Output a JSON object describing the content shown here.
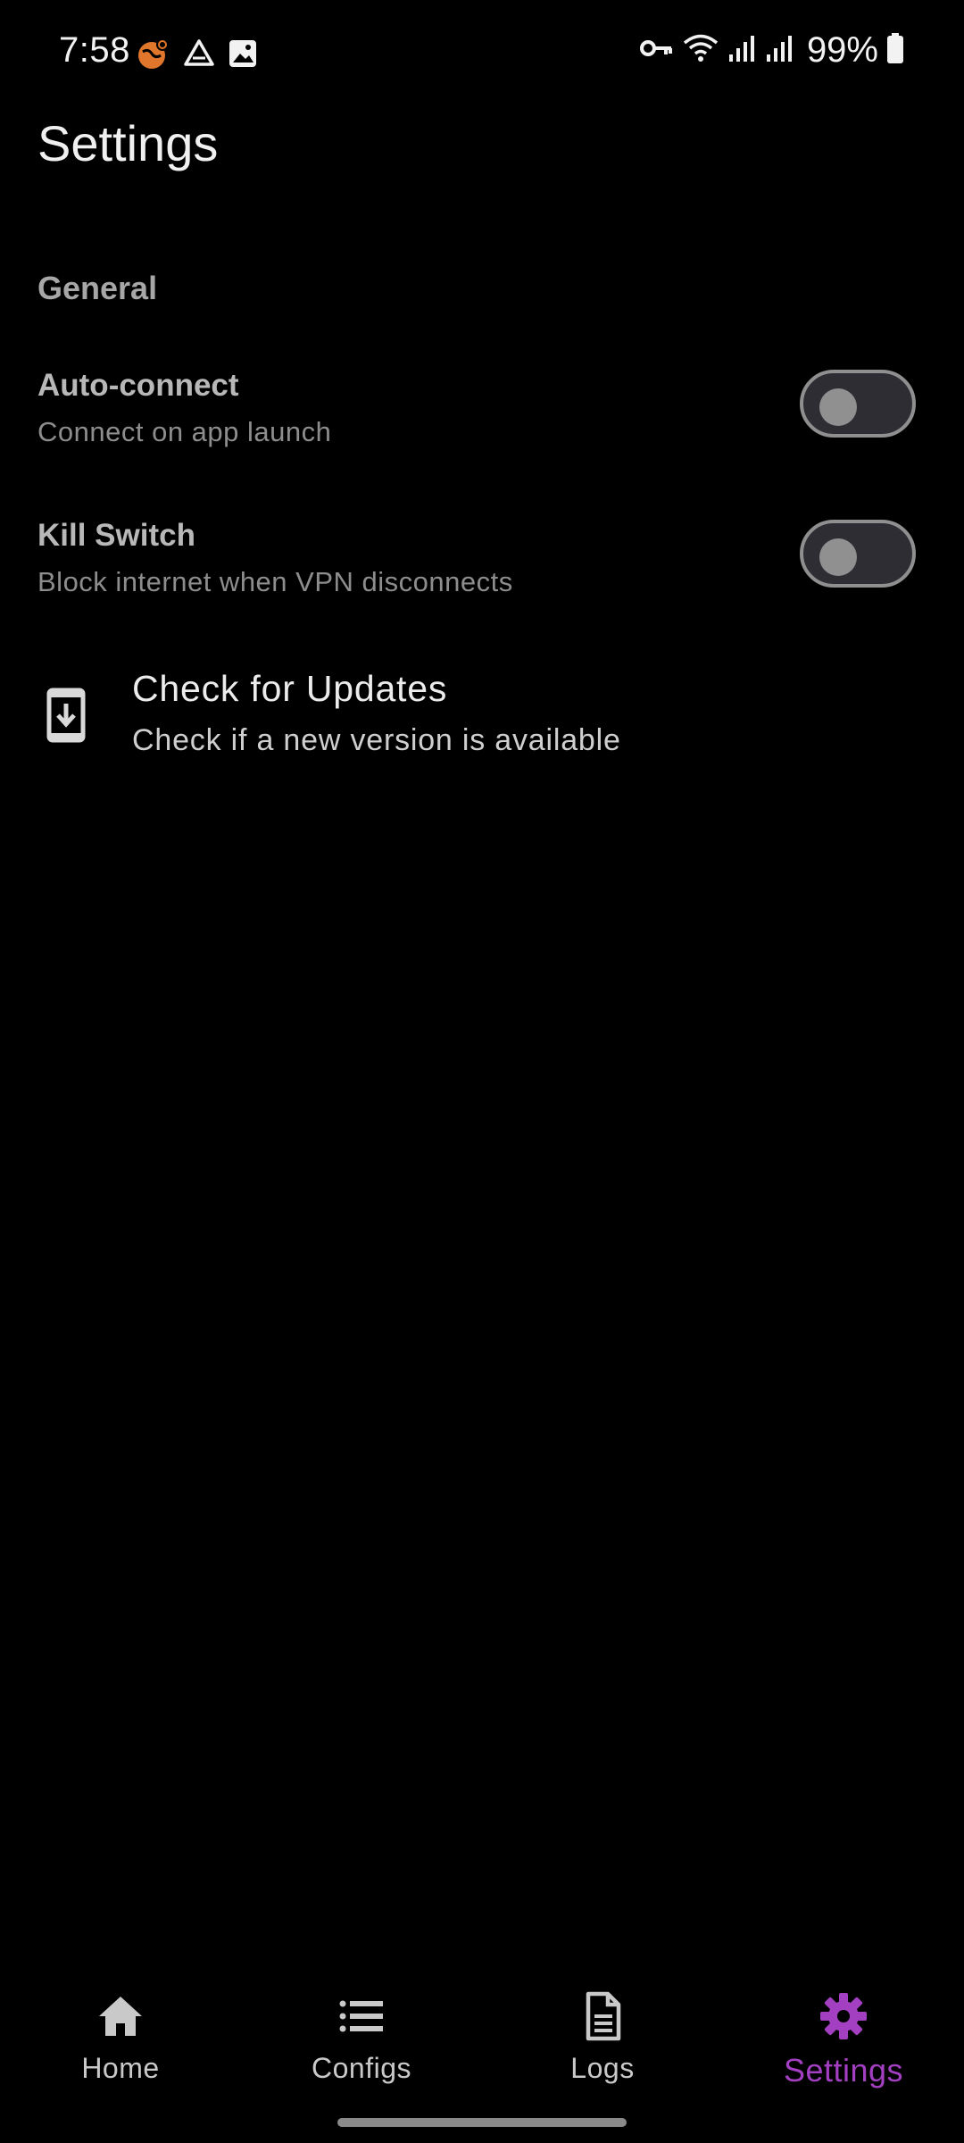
{
  "status_bar": {
    "time": "7:58",
    "battery_percent": "99%",
    "left_icons": [
      "vpn-globe-icon",
      "drive-icon",
      "gallery-icon"
    ],
    "right_icons": [
      "vpn-key-icon",
      "wifi-icon",
      "signal-icon",
      "signal-icon",
      "battery-icon"
    ]
  },
  "page": {
    "title": "Settings"
  },
  "sections": {
    "general": {
      "header": "General",
      "auto_connect": {
        "title": "Auto-connect",
        "subtitle": "Connect on app launch",
        "enabled": false
      },
      "kill_switch": {
        "title": "Kill Switch",
        "subtitle": "Block internet when VPN disconnects",
        "enabled": false
      }
    },
    "updates": {
      "title": "Check for Updates",
      "subtitle": "Check if a new version is available",
      "icon": "download-phone-icon"
    }
  },
  "bottom_nav": {
    "items": [
      {
        "label": "Home",
        "icon": "home-icon",
        "active": false
      },
      {
        "label": "Configs",
        "icon": "list-icon",
        "active": false
      },
      {
        "label": "Logs",
        "icon": "document-icon",
        "active": false
      },
      {
        "label": "Settings",
        "icon": "gear-icon",
        "active": true
      }
    ]
  },
  "colors": {
    "background": "#000000",
    "accent": "#a33fc1",
    "vpn_icon": "#e0762b"
  }
}
